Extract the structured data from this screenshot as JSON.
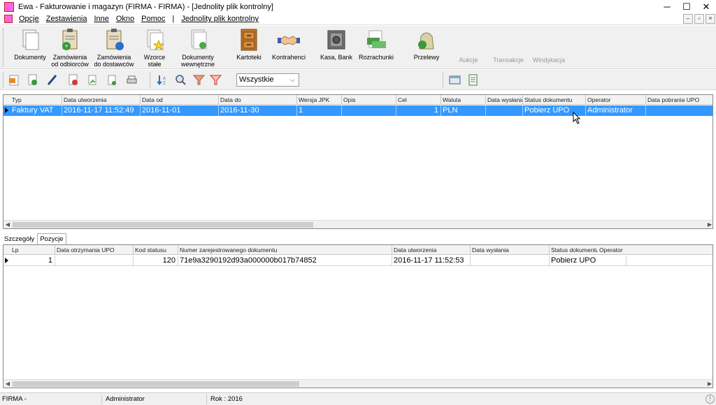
{
  "window": {
    "title": "Ewa - Fakturowanie i magazyn (FIRMA - FIRMA) - [Jednolity plik kontrolny]",
    "minimize": "─",
    "maximize": "☐",
    "close": "✕"
  },
  "menu": {
    "items": [
      "Opcje",
      "Zestawienia",
      "Inne",
      "Okno",
      "Pomoc",
      "|",
      "Jednolity plik kontrolny"
    ],
    "mdi_buttons": [
      "–",
      "▫",
      "×"
    ]
  },
  "big_toolbar": [
    {
      "label": "Dokumenty",
      "icon": "documents-icon",
      "enabled": true
    },
    {
      "label": "Zamówienia\nod odbiorców",
      "icon": "customer-orders-icon",
      "enabled": true
    },
    {
      "label": "Zamówienia\ndo dostawców",
      "icon": "supplier-orders-icon",
      "enabled": true
    },
    {
      "label": "Wzorce\nstałe",
      "icon": "templates-icon",
      "enabled": true
    },
    {
      "label": "Dokumenty\nwewnętrzne",
      "icon": "internal-documents-icon",
      "enabled": true
    },
    {
      "label": "Kartoteki",
      "icon": "card-files-icon",
      "enabled": true
    },
    {
      "label": "Kontrahenci",
      "icon": "handshake-icon",
      "enabled": true
    },
    {
      "label": "Kasa, Bank",
      "icon": "safe-icon",
      "enabled": true
    },
    {
      "label": "Rozrachunki",
      "icon": "settlements-icon",
      "enabled": true
    },
    {
      "label": "Przelewy",
      "icon": "transfers-icon",
      "enabled": true
    },
    {
      "label": "Aukcje",
      "icon": "",
      "enabled": false
    },
    {
      "label": "Transakcje",
      "icon": "",
      "enabled": false
    },
    {
      "label": "Windykacja",
      "icon": "",
      "enabled": false
    }
  ],
  "filter": {
    "selected": "Wszystkie"
  },
  "main_grid": {
    "columns": [
      "Typ",
      "Data utworzenia",
      "Data od",
      "Data do",
      "Wersja JPK",
      "Opis",
      "Cel",
      "Waluta",
      "Data wysłania",
      "Status dokumentu",
      "Operator",
      "Data pobrania UPO"
    ],
    "rows": [
      [
        "Faktury VAT",
        "2016-11-17 11:52:49",
        "2016-11-01",
        "2016-11-30",
        "1",
        "",
        "1",
        "PLN",
        "",
        "Pobierz UPO",
        "Administrator",
        ""
      ]
    ]
  },
  "tabs": [
    "Szczegóły",
    "Pozycje"
  ],
  "detail_grid": {
    "columns": [
      "Lp",
      "Data otrzymania UPO",
      "Kod statusu",
      "Numer zarejestrowanego dokumentu",
      "Data utworzenia",
      "Data wysłania",
      "Status dokumentu",
      "Operator"
    ],
    "rows": [
      [
        "1",
        "",
        "120",
        "71e9a3290192d93a000000b017b74852",
        "2016-11-17 11:52:53",
        "",
        "Pobierz UPO",
        ""
      ]
    ]
  },
  "status_bar": {
    "company": "FIRMA -",
    "user": "Administrator",
    "year": "Rok : 2016"
  }
}
